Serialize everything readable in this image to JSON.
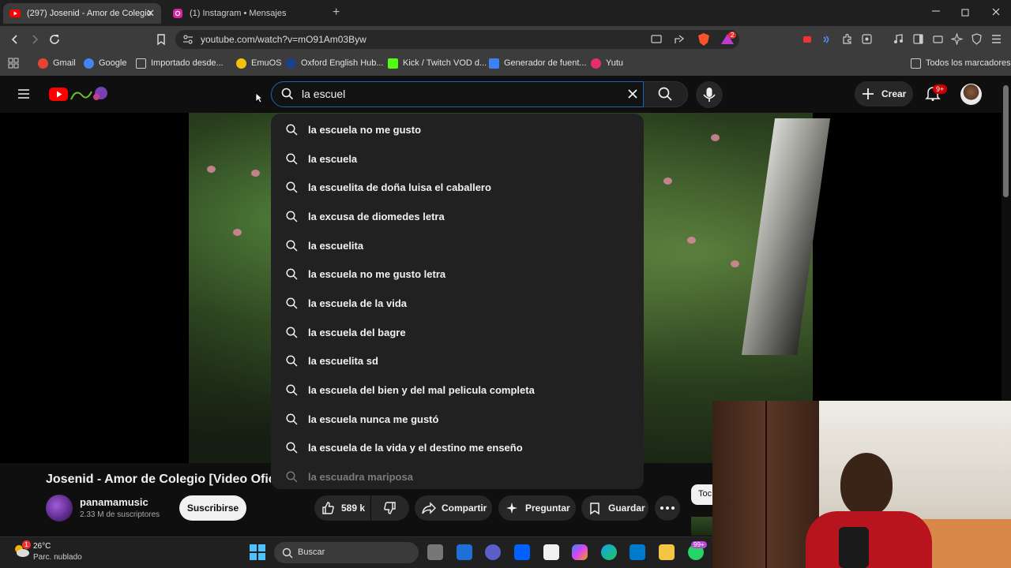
{
  "browser": {
    "tabs": [
      {
        "title": "(297) Josenid - Amor de Colegio",
        "close": "✕"
      },
      {
        "title": "(1) Instagram • Mensajes"
      }
    ],
    "new_tab": "+",
    "url": "youtube.com/watch?v=mO91Am03Byw",
    "extension_badges": {
      "brave": "2"
    },
    "bookmarks": [
      {
        "label": "Gmail",
        "color": "#ea4335"
      },
      {
        "label": "Google",
        "color": "#4285f4"
      },
      {
        "label": "Importado desde...",
        "color": "#cccccc"
      },
      {
        "label": "EmuOS",
        "color": "#f4c20d"
      },
      {
        "label": "Oxford English Hub...",
        "color": "#1d3f8c"
      },
      {
        "label": "Kick / Twitch VOD d...",
        "color": "#53fc18"
      },
      {
        "label": "Generador de fuent...",
        "color": "#3b82f6"
      },
      {
        "label": "Yutu",
        "color": "#e1306c"
      }
    ],
    "all_bookmarks": "Todos los marcadores"
  },
  "youtube": {
    "search_value": "la escuel",
    "create_label": "Crear",
    "notif_badge": "9+",
    "suggestions": [
      "la escuela no me gusto",
      "la escuela",
      "la escuelita de doña luisa el caballero",
      "la excusa de diomedes letra",
      "la escuelita",
      "la escuela no me gusto letra",
      "la escuela de la vida",
      "la escuela del bagre",
      "la escuelita sd",
      "la escuela del bien y del mal pelicula completa",
      "la escuela nunca me gustó",
      "la escuela de la vida y el destino me enseño",
      "la escuadra mariposa"
    ],
    "video_title": "Josenid - Amor de Colegio [Video Ofic",
    "channel": "panamamusic",
    "subscribers": "2.33 M de suscriptores",
    "subscribe_label": "Suscribirse",
    "likes": "589 k",
    "share_label": "Compartir",
    "ask_label": "Preguntar",
    "save_label": "Guardar",
    "chip_partial": "Toc",
    "accent": "#ff0000"
  },
  "taskbar": {
    "weather_temp": "26°C",
    "weather_desc": "Parc. nublado",
    "weather_badge": "1",
    "search_label": "Buscar",
    "whatsapp_badge": "99+"
  }
}
